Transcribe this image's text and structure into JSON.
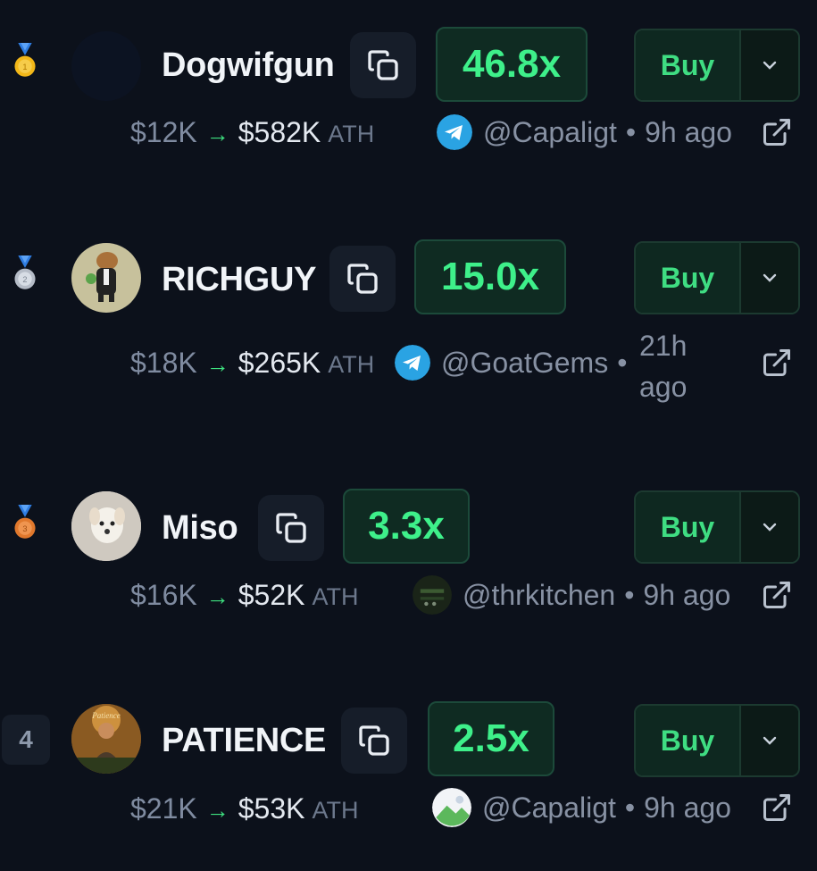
{
  "rows": [
    {
      "rank": "1",
      "rank_icon": "gold-medal-icon",
      "name": "Dogwifgun",
      "multiplier": "46.8x",
      "from_mc": "$12K",
      "to_mc": "$582K",
      "ath_label": "ATH",
      "source": "@Capaligt",
      "source_icon": "telegram-icon",
      "time": "9h ago",
      "buy_label": "Buy"
    },
    {
      "rank": "2",
      "rank_icon": "silver-medal-icon",
      "name": "RICHGUY",
      "multiplier": "15.0x",
      "from_mc": "$18K",
      "to_mc": "$265K",
      "ath_label": "ATH",
      "source": "@GoatGems",
      "source_icon": "telegram-icon",
      "time_line1": "21h",
      "time_line2": "ago",
      "buy_label": "Buy"
    },
    {
      "rank": "3",
      "rank_icon": "bronze-medal-icon",
      "name": "Miso",
      "multiplier": "3.3x",
      "from_mc": "$16K",
      "to_mc": "$52K",
      "ath_label": "ATH",
      "source": "@thrkitchen",
      "source_icon": "profile-thumbnail-icon",
      "time": "9h ago",
      "buy_label": "Buy"
    },
    {
      "rank": "4",
      "name": "PATIENCE",
      "multiplier": "2.5x",
      "from_mc": "$21K",
      "to_mc": "$53K",
      "ath_label": "ATH",
      "source": "@Capaligt",
      "source_icon": "image-placeholder-icon",
      "time": "9h ago",
      "buy_label": "Buy"
    }
  ],
  "arrow_glyph": "→",
  "separator": "•",
  "colors": {
    "background": "#0c111b",
    "accent_green": "#3ef08a",
    "muted": "#7f8ba0"
  },
  "avatar_label_row4": "Patience"
}
